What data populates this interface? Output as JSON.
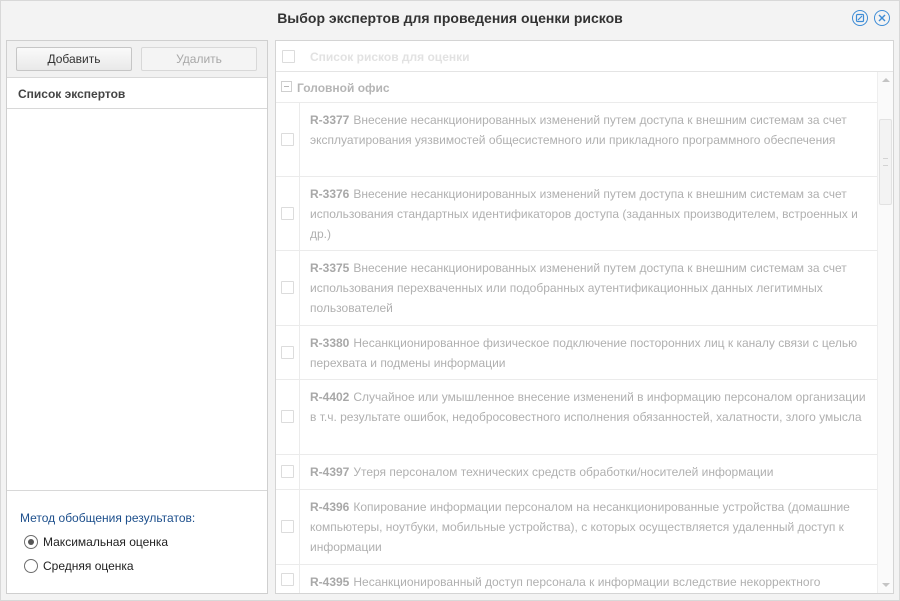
{
  "dialog": {
    "title": "Выбор экспертов для проведения оценки рисков"
  },
  "title_icons": [
    "settings-icon",
    "close-icon"
  ],
  "toolbar": {
    "add_label": "Добавить",
    "delete_label": "Удалить"
  },
  "experts": {
    "header": "Список экспертов",
    "items": []
  },
  "method": {
    "label": "Метод обобщения результатов:",
    "options": [
      {
        "label": "Максимальная оценка",
        "checked": true
      },
      {
        "label": "Средняя оценка",
        "checked": false
      }
    ]
  },
  "risks": {
    "header": "Список рисков для оценки",
    "group": "Головной офис",
    "items": [
      {
        "code": "R-3377",
        "text": "Внесение несанкционированных изменений путем доступа к внешним системам за счет эксплуатирования уязвимостей общесистемного или прикладного программного обеспечения"
      },
      {
        "code": "R-3376",
        "text": "Внесение несанкционированных изменений путем доступа к внешним системам за счет использования стандартных идентификаторов доступа (заданных производителем, встроенных и др.)"
      },
      {
        "code": "R-3375",
        "text": "Внесение несанкционированных изменений путем доступа к внешним системам за счет использования перехваченных или подобранных аутентификационных данных легитимных пользователей"
      },
      {
        "code": "R-3380",
        "text": "Несанкционированное физическое подключение посторонних лиц к каналу связи с целью перехвата и подмены информации"
      },
      {
        "code": "R-4402",
        "text": "Случайное или умышленное внесение изменений в информацию персоналом организации в т.ч. результате ошибок, недобросовестного исполнения обязанностей, халатности, злого умысла"
      },
      {
        "code": "R-4397",
        "text": "Утеря персоналом технических средств обработки/носителей информации"
      },
      {
        "code": "R-4396",
        "text": "Копирование информации персоналом на несанкционированные устройства (домашние компьютеры, ноутбуки, мобильные устройства), с которых осуществляется удаленный доступ к информации"
      },
      {
        "code": "R-4395",
        "text": "Несанкционированный доступ персонала к информации вследствие некорректного"
      }
    ]
  },
  "colors": {
    "accent": "#3d8cd6",
    "method_label": "#1d4f8c"
  }
}
